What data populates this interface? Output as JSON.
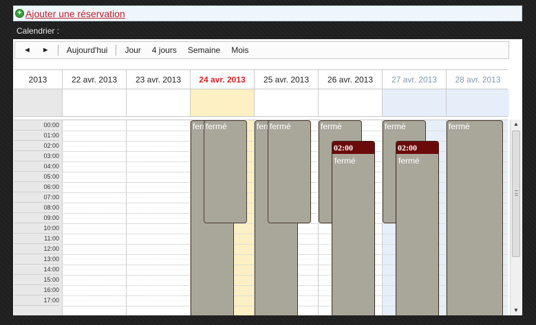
{
  "add_reservation": {
    "label": "Ajouter une réservation",
    "icon": "plus-circle-icon"
  },
  "calendar_label": "Calendrier :",
  "toolbar": {
    "prev": "◄",
    "next": "►",
    "today": "Aujourd'hui",
    "day": "Jour",
    "four_days": "4 jours",
    "week": "Semaine",
    "month": "Mois"
  },
  "header": {
    "year": "2013",
    "days": [
      {
        "label": "22 avr. 2013"
      },
      {
        "label": "23 avr. 2013"
      },
      {
        "label": "24 avr. 2013"
      },
      {
        "label": "25 avr. 2013"
      },
      {
        "label": "26 avr. 2013"
      },
      {
        "label": "27 avr. 2013"
      },
      {
        "label": "28 avr. 2013"
      }
    ]
  },
  "time_slots": [
    "00:00",
    "01:00",
    "02:00",
    "03:00",
    "04:00",
    "05:00",
    "06:00",
    "07:00",
    "08:00",
    "09:00",
    "10:00",
    "11:00",
    "12:00",
    "13:00",
    "14:00",
    "15:00",
    "16:00",
    "17:00"
  ],
  "events": {
    "label_ferme": "fermé",
    "label_ferme_short": "ferr",
    "label_time": "02:00"
  },
  "colors": {
    "today": "#d81f1f",
    "weekend": "#7f97b0",
    "today_bg": "#fdf0c2",
    "weekend_bg": "#e6eff9",
    "event_bg": "#a9a69a",
    "event_head_bg": "#6b0a0a"
  }
}
